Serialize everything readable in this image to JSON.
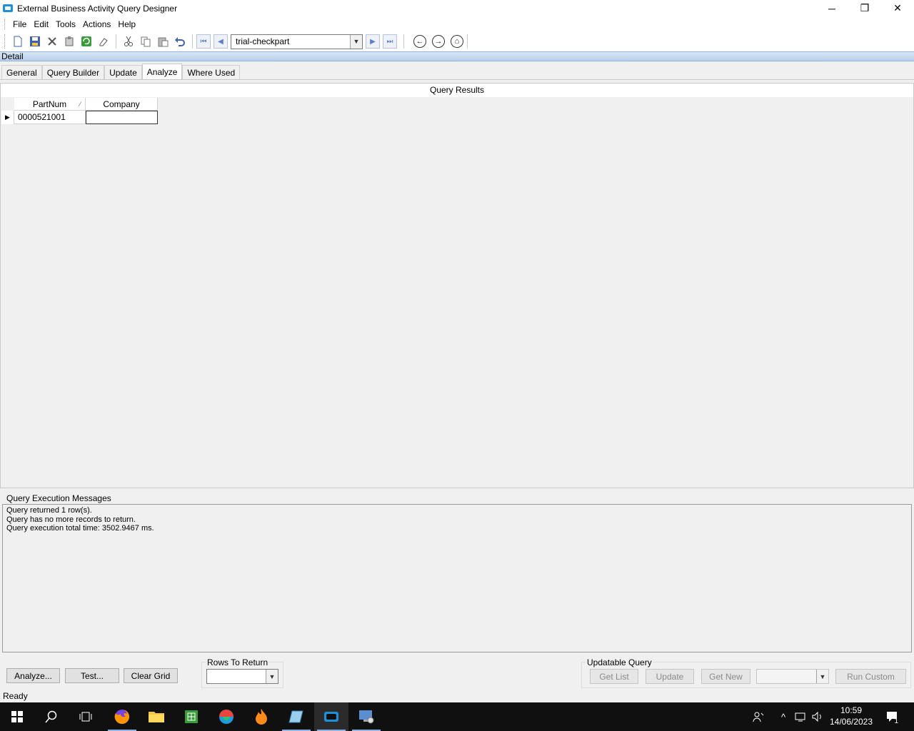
{
  "window": {
    "title": "External Business Activity Query Designer",
    "minimize": "─",
    "restore": "❐",
    "close": "✕"
  },
  "menu": {
    "items": [
      "File",
      "Edit",
      "Tools",
      "Actions",
      "Help"
    ]
  },
  "toolbar": {
    "query_id": "trial-checkpart"
  },
  "detail_bar": {
    "label": "Detail"
  },
  "tabs": [
    "General",
    "Query Builder",
    "Update",
    "Analyze",
    "Where Used"
  ],
  "active_tab": "Analyze",
  "results": {
    "caption": "Query Results",
    "columns": [
      "PartNum",
      "Company"
    ],
    "rows": [
      [
        "0000521001",
        ""
      ]
    ]
  },
  "messages": {
    "label": "Query Execution Messages",
    "lines": [
      "Query returned 1 row(s).",
      "Query has no more records to return.",
      "Query execution total time: 3502.9467 ms."
    ]
  },
  "bottom": {
    "analyze_label": "Analyze...",
    "test_label": "Test...",
    "clear_grid_label": "Clear Grid",
    "rows_to_return_label": "Rows To Return",
    "rows_to_return_value": "",
    "updatable_query_label": "Updatable Query",
    "get_list_label": "Get List",
    "update_label": "Update",
    "get_new_label": "Get New",
    "run_custom_label": "Run Custom"
  },
  "status": {
    "text": "Ready"
  },
  "taskbar": {
    "time": "10:59",
    "date": "14/06/2023",
    "notification_count": "1"
  },
  "colors": {
    "detail_bar": "#b9cfeb",
    "taskbar": "#101010",
    "accent": "#1e90d8"
  }
}
